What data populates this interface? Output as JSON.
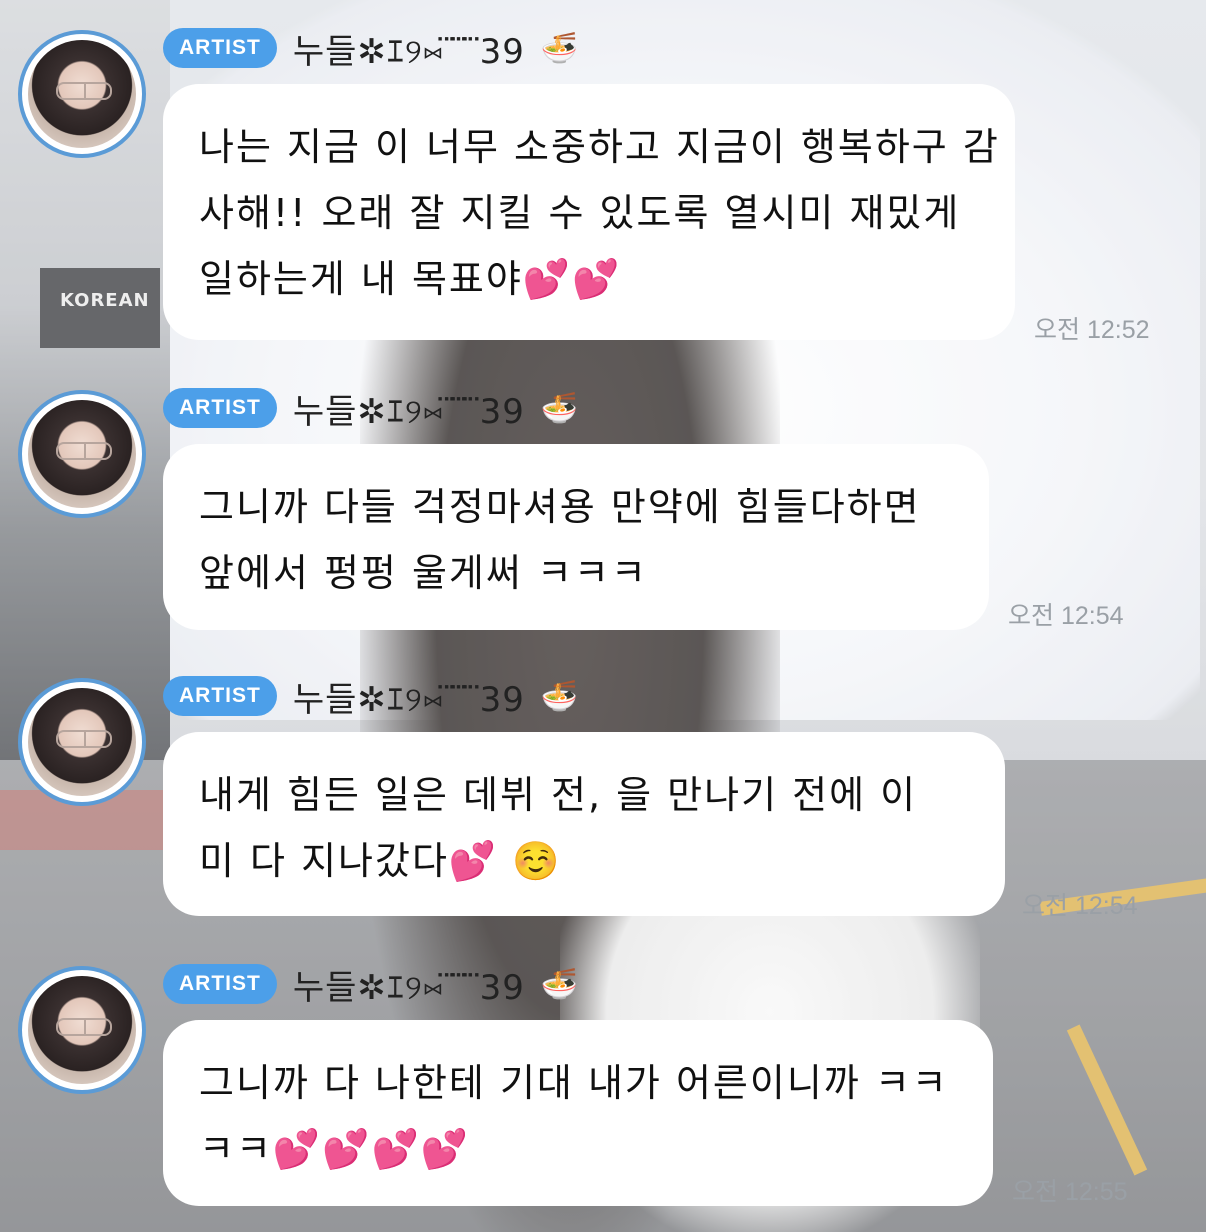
{
  "messages": [
    {
      "badge": "ARTIST",
      "sender": "누들✲ｴ୨⑅ ⃛ ⃛ ⃛39",
      "sender_icon": "🍜",
      "lines": [
        "나는 지금        이 너무 소중하고 지금이 행복하구 감",
        "사해!! 오래 잘 지킬 수 있도록 열시미 재밌게",
        "일하는게 내 목표야💕💕"
      ],
      "time": "오전 12:52"
    },
    {
      "badge": "ARTIST",
      "sender": "누들✲ｴ୨⑅ ⃛ ⃛ ⃛39",
      "sender_icon": "🍜",
      "lines": [
        "그니까 다들 걱정마셔용 만약에 힘들다하면",
        "     앞에서 펑펑 울게써 ㅋㅋㅋ"
      ],
      "time": "오전 12:54"
    },
    {
      "badge": "ARTIST",
      "sender": "누들✲ｴ୨⑅ ⃛ ⃛ ⃛39",
      "sender_icon": "🍜",
      "lines": [
        "내게 힘든 일은 데뷔 전,       을 만나기 전에 이",
        "미 다 지나갔다💕 ☺️"
      ],
      "time": "오전 12:54"
    },
    {
      "badge": "ARTIST",
      "sender": "누들✲ｴ୨⑅ ⃛ ⃛ ⃛39",
      "sender_icon": "🍜",
      "lines": [
        "그니까 다 나한테 기대 내가 어른이니까 ㅋㅋ",
        "ㅋㅋ💕💕💕💕"
      ],
      "time": "오전 12:55"
    }
  ]
}
